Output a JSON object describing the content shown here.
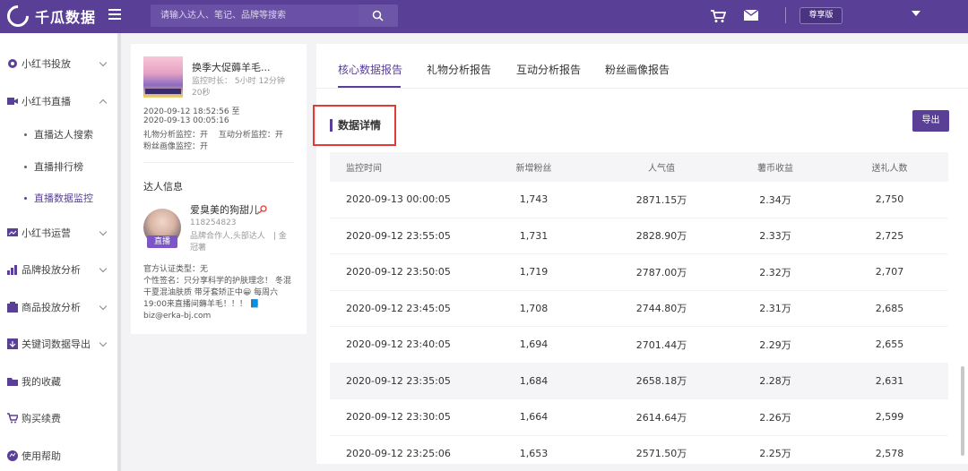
{
  "app": {
    "name": "千瓜数据"
  },
  "search": {
    "placeholder": "请输入达人、笔记、品牌等搜索"
  },
  "header": {
    "vip_label": "尊享版"
  },
  "colors": {
    "brand": "#5a3f97",
    "highlight_box": "#e53935"
  },
  "sidebar": {
    "items": [
      {
        "label": "小红书投放",
        "icon": "rocket-icon"
      },
      {
        "label": "小红书直播",
        "icon": "video-icon"
      },
      {
        "label": "小红书运营",
        "icon": "chart-board-icon"
      },
      {
        "label": "品牌投放分析",
        "icon": "bar-chart-icon"
      },
      {
        "label": "商品投放分析",
        "icon": "goods-icon"
      },
      {
        "label": "关键词数据导出",
        "icon": "export-icon"
      },
      {
        "label": "我的收藏",
        "icon": "folder-icon"
      },
      {
        "label": "购买续费",
        "icon": "cart-icon"
      },
      {
        "label": "使用帮助",
        "icon": "help-icon"
      }
    ],
    "sub_items": [
      {
        "label": "直播达人搜索"
      },
      {
        "label": "直播排行榜"
      },
      {
        "label": "直播数据监控"
      }
    ]
  },
  "live_card": {
    "title": "换季大促薅羊毛...",
    "duration": "监控时长： 5小时 12分钟 20秒",
    "time_range_start": "2020-09-12 18:52:56 至",
    "time_range_end": "2020-09-13 00:05:16",
    "monitor_status_1": "礼物分析监控：开　 互动分析监控：开",
    "monitor_status_2": "粉丝画像监控：开",
    "section_title": "达人信息",
    "talent_name": "爱臭美的狗甜儿",
    "talent_id": "118254823",
    "talent_tags": "品牌合作人,头部达人　| 金冠薯",
    "live_tag": "直播",
    "bio": "官方认证类型：无\n个性签名：只分享科学的护肤理念！ 冬混干夏混油肤质 带牙套矫正中😀 每周六19:00来直播间薅羊毛！！！ 📘\nbiz@erka-bj.com"
  },
  "tabs": [
    {
      "label": "核心数据报告"
    },
    {
      "label": "礼物分析报告"
    },
    {
      "label": "互动分析报告"
    },
    {
      "label": "粉丝画像报告"
    }
  ],
  "section": {
    "title": "数据详情",
    "export_label": "导出"
  },
  "table": {
    "columns": [
      "监控时间",
      "新增粉丝",
      "人气值",
      "薯币收益",
      "送礼人数"
    ],
    "rows": [
      [
        "2020-09-13 00:00:05",
        "1,743",
        "2871.15万",
        "2.34万",
        "2,750"
      ],
      [
        "2020-09-12 23:55:05",
        "1,731",
        "2828.90万",
        "2.33万",
        "2,725"
      ],
      [
        "2020-09-12 23:50:05",
        "1,719",
        "2787.00万",
        "2.32万",
        "2,707"
      ],
      [
        "2020-09-12 23:45:05",
        "1,708",
        "2744.80万",
        "2.31万",
        "2,685"
      ],
      [
        "2020-09-12 23:40:05",
        "1,694",
        "2701.44万",
        "2.29万",
        "2,655"
      ],
      [
        "2020-09-12 23:35:05",
        "1,684",
        "2658.18万",
        "2.28万",
        "2,631"
      ],
      [
        "2020-09-12 23:30:05",
        "1,664",
        "2614.64万",
        "2.26万",
        "2,599"
      ],
      [
        "2020-09-12 23:25:06",
        "1,653",
        "2571.50万",
        "2.25万",
        "2,578"
      ]
    ]
  }
}
